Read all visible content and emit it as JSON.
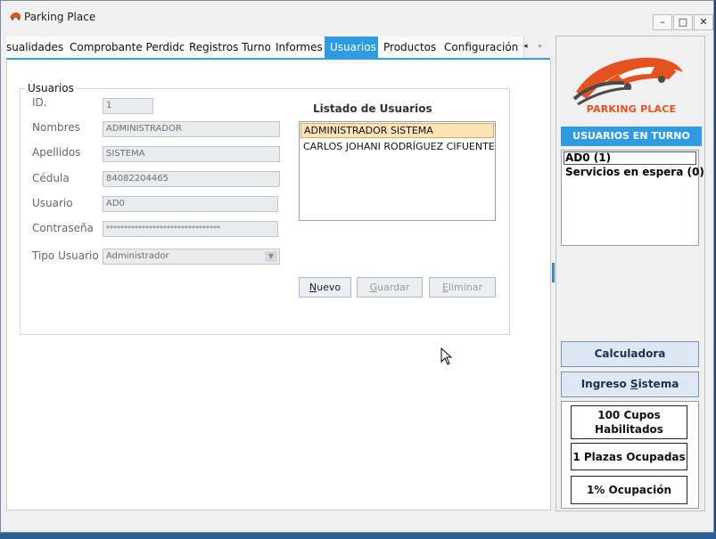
{
  "window": {
    "title": "Parking Place",
    "controls": {
      "minimize": "–",
      "maximize": "□",
      "close": "✕"
    }
  },
  "tabs": [
    {
      "label": "sualidades",
      "active": false
    },
    {
      "label": "Comprobante Perdido",
      "active": false
    },
    {
      "label": "Registros Turno",
      "active": false
    },
    {
      "label": "Informes",
      "active": false
    },
    {
      "label": "Usuarios",
      "active": true
    },
    {
      "label": "Productos",
      "active": false
    },
    {
      "label": "Configuración",
      "active": false
    }
  ],
  "tab_scroll": {
    "left": "◂",
    "right": "▸"
  },
  "users_form": {
    "group_title": "Usuarios",
    "id_label": "ID.",
    "id_value": "1",
    "nombres_label": "Nombres",
    "nombres_value": "ADMINISTRADOR",
    "apellidos_label": "Apellidos",
    "apellidos_value": "SISTEMA",
    "cedula_label": "Cédula",
    "cedula_value": "84082204465",
    "usuario_label": "Usuario",
    "usuario_value": "AD0",
    "contrasena_label": "Contraseña",
    "contrasena_value": "********************************",
    "tipo_label": "Tipo Usuario",
    "tipo_value": "Administrador",
    "list_title": "Listado de Usuarios",
    "users": [
      "ADMINISTRADOR SISTEMA",
      "CARLOS JOHANI RODRÍGUEZ CIFUENTES"
    ],
    "selected_user_index": 0,
    "buttons": {
      "nuevo_first": "N",
      "nuevo_rest": "uevo",
      "guardar_first": "G",
      "guardar_rest": "uardar",
      "eliminar_first": "E",
      "eliminar_rest": "liminar"
    }
  },
  "side_panel": {
    "logo_text": "PARKING PLACE",
    "turn_header": "USUARIOS EN TURNO",
    "turn_items": [
      "AD0 (1)",
      "Servicios en espera (0)"
    ],
    "calculator_button": "Calculadora",
    "ingreso_prefix": "Ingreso ",
    "ingreso_underlined": "S",
    "ingreso_suffix": "istema",
    "stats": {
      "cupos_line1": "100 Cupos",
      "cupos_line2": "Habilitados",
      "plazas": "1 Plazas Ocupadas",
      "ocupacion": "1% Ocupación"
    }
  },
  "colors": {
    "accent": "#2f9be0",
    "logo_orange": "#e3521f",
    "selection": "#fde3b6"
  }
}
